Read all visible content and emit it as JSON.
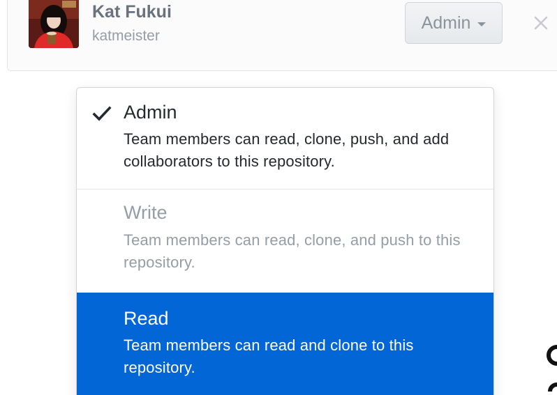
{
  "member": {
    "name": "Kat Fukui",
    "login": "katmeister",
    "role_button_label": "Admin"
  },
  "role_menu": {
    "selected": "Admin",
    "highlighted": "Read",
    "options": [
      {
        "title": "Admin",
        "description": "Team members can read, clone, push, and add collaborators to this repository.",
        "checked": true,
        "state": "normal"
      },
      {
        "title": "Write",
        "description": "Team members can read, clone, and push to this repository.",
        "checked": false,
        "state": "disabled"
      },
      {
        "title": "Read",
        "description": "Team members can read and clone to this repository.",
        "checked": false,
        "state": "highlighted"
      }
    ]
  },
  "icons": {
    "avatar": "user-avatar-photo",
    "role_caret": "caret-down-icon",
    "remove": "close-icon",
    "selected_mark": "check-icon"
  },
  "colors": {
    "highlight": "#0366d6",
    "text_primary": "#24292e",
    "text_muted": "#959da5",
    "border": "#e1e4e8"
  }
}
